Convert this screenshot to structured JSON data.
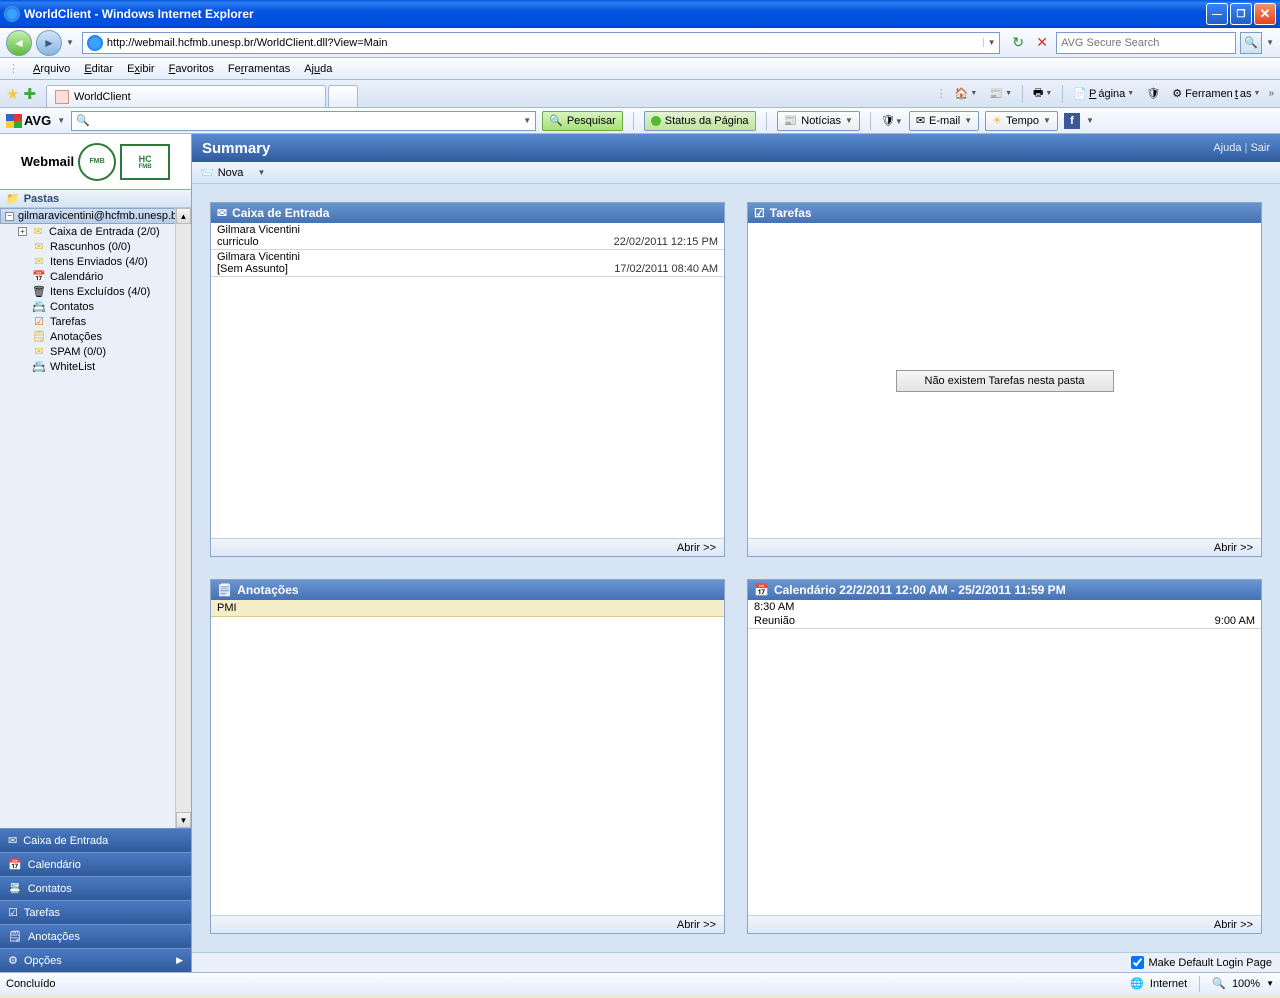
{
  "window": {
    "title": "WorldClient - Windows Internet Explorer"
  },
  "nav": {
    "url": "http://webmail.hcfmb.unesp.br/WorldClient.dll?View=Main",
    "search_placeholder": "AVG Secure Search"
  },
  "menu": {
    "arquivo": "Arquivo",
    "editar": "Editar",
    "exibir": "Exibir",
    "favoritos": "Favoritos",
    "ferramentas": "Ferramentas",
    "ajuda": "Ajuda"
  },
  "tab": {
    "title": "WorldClient"
  },
  "ietb": {
    "pagina": "Página",
    "ferramentas": "Ferramentas"
  },
  "avg": {
    "brand": "AVG",
    "pesquisar": "Pesquisar",
    "status": "Status da Página",
    "noticias": "Notícias",
    "email": "E-mail",
    "tempo": "Tempo"
  },
  "logo": {
    "webmail": "Webmail",
    "fmb": "FMB",
    "hc1": "HC",
    "hc2": "FMB"
  },
  "folders": {
    "header": "Pastas",
    "account": "gilmaravicentini@hcfmb.unesp.br",
    "items": [
      {
        "label": "Caixa de Entrada (2/0)"
      },
      {
        "label": "Rascunhos (0/0)"
      },
      {
        "label": "Itens Enviados (4/0)"
      },
      {
        "label": "Calendário"
      },
      {
        "label": "Itens Excluídos (4/0)"
      },
      {
        "label": "Contatos"
      },
      {
        "label": "Tarefas"
      },
      {
        "label": "Anotações"
      },
      {
        "label": "SPAM (0/0)"
      },
      {
        "label": "WhiteList"
      }
    ]
  },
  "navbuttons": [
    {
      "label": "Caixa de Entrada"
    },
    {
      "label": "Calendário"
    },
    {
      "label": "Contatos"
    },
    {
      "label": "Tarefas"
    },
    {
      "label": "Anotações"
    },
    {
      "label": "Opções"
    }
  ],
  "summary": {
    "title": "Summary",
    "ajuda": "Ajuda",
    "sair": "Sair",
    "nova": "Nova"
  },
  "panels": {
    "inbox": {
      "title": "Caixa de Entrada",
      "messages": [
        {
          "from": "Gilmara Vicentini",
          "subject": "curriculo",
          "date": "22/02/2011 12:15 PM"
        },
        {
          "from": "Gilmara Vicentini",
          "subject": "[Sem Assunto]",
          "date": "17/02/2011 08:40 AM"
        }
      ],
      "abrir": "Abrir >>"
    },
    "tasks": {
      "title": "Tarefas",
      "empty": "Não existem Tarefas nesta pasta",
      "abrir": "Abrir >>"
    },
    "notes": {
      "title": "Anotações",
      "items": [
        {
          "text": "PMI"
        }
      ],
      "abrir": "Abrir >>"
    },
    "calendar": {
      "title": "Calendário 22/2/2011 12:00 AM - 25/2/2011 11:59 PM",
      "slot": "8:30 AM",
      "event": "Reunião",
      "event_time": "9:00 AM",
      "abrir": "Abrir >>"
    }
  },
  "opts": {
    "default_login": "Make Default Login Page"
  },
  "status": {
    "done": "Concluído",
    "zone": "Internet",
    "zoom": "100%"
  }
}
